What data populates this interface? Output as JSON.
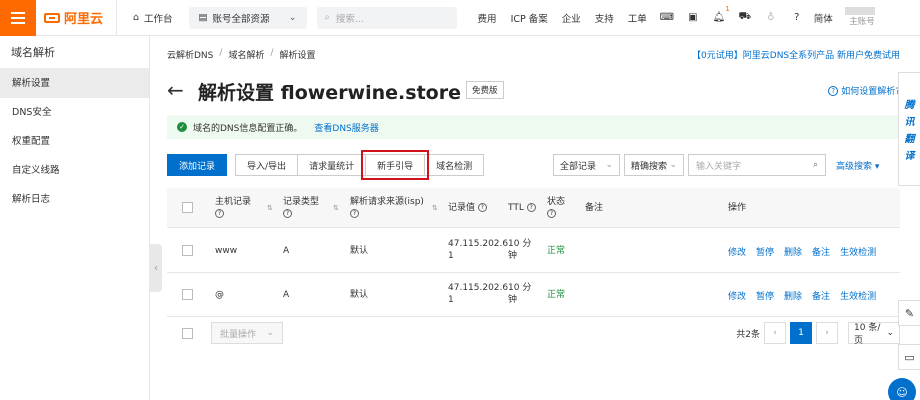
{
  "topbar": {
    "logo_text": "阿里云",
    "workbench": "工作台",
    "resources": "账号全部资源",
    "search_placeholder": "搜索...",
    "links": [
      "费用",
      "ICP 备案",
      "企业",
      "支持",
      "工单"
    ],
    "cart_badge": "1",
    "lang": "简体",
    "user_sub": "主账号"
  },
  "sidebar": {
    "title": "域名解析",
    "items": [
      "解析设置",
      "DNS安全",
      "权重配置",
      "自定义线路",
      "解析日志"
    ]
  },
  "breadcrumb": [
    "云解析DNS",
    "域名解析",
    "解析设置"
  ],
  "promo": "【0元试用】阿里云DNS全系列产品 新用户免费试用",
  "header": {
    "title": "解析设置 flowerwine.store",
    "tag": "免费版",
    "help": "如何设置解析?"
  },
  "alert": {
    "text": "域名的DNS信息配置正确。",
    "link": "查看DNS服务器"
  },
  "toolbar": {
    "add": "添加记录",
    "import": "导入/导出",
    "stats": "请求量统计",
    "guide": "新手引导",
    "check": "域名检测"
  },
  "filters": {
    "all_records": "全部记录",
    "exact": "精确搜索",
    "keyword_placeholder": "输入关键字",
    "advanced": "高级搜索"
  },
  "table": {
    "headers": {
      "host": "主机记录",
      "type": "记录类型",
      "isp": "解析请求来源(isp)",
      "value": "记录值",
      "ttl": "TTL",
      "status": "状态",
      "remark": "备注",
      "ops": "操作"
    },
    "rows": [
      {
        "host": "www",
        "type": "A",
        "isp": "默认",
        "value_l1": "47.115.202.6",
        "value_l2": "1",
        "ttl_l1": "10 分",
        "ttl_l2": "钟",
        "status": "正常"
      },
      {
        "host": "@",
        "type": "A",
        "isp": "默认",
        "value_l1": "47.115.202.6",
        "value_l2": "1",
        "ttl_l1": "10 分",
        "ttl_l2": "钟",
        "status": "正常"
      }
    ],
    "ops": [
      "修改",
      "暂停",
      "删除",
      "备注",
      "生效检测"
    ]
  },
  "footer": {
    "batch": "批量操作",
    "total": "共2条",
    "page": "1",
    "page_size": "10 条/页"
  },
  "side_banner": [
    "腾",
    "讯",
    "翻",
    "译"
  ]
}
